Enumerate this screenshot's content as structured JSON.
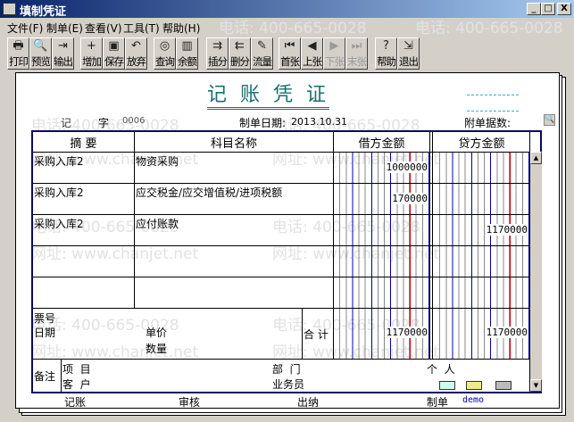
{
  "window": {
    "title": "填制凭证",
    "minimize": "_",
    "maximize": "□",
    "close": "X"
  },
  "menu": [
    "文件(F)",
    "制单(E)",
    "查看(V)",
    "工具(T)",
    "帮助(H)"
  ],
  "toolbar": [
    {
      "label": "打印",
      "icon": "printer-icon",
      "glyph": "🖶"
    },
    {
      "label": "预览",
      "icon": "preview-icon",
      "glyph": "🔍"
    },
    {
      "label": "输出",
      "icon": "export-icon",
      "glyph": "⇥"
    },
    {
      "label": "增加",
      "icon": "add-icon",
      "glyph": "+"
    },
    {
      "label": "保存",
      "icon": "save-icon",
      "glyph": "▣"
    },
    {
      "label": "放弃",
      "icon": "undo-icon",
      "glyph": "↶"
    },
    {
      "label": "查询",
      "icon": "binoculars-icon",
      "glyph": "◎"
    },
    {
      "label": "余额",
      "icon": "chart-icon",
      "glyph": "▥"
    },
    {
      "label": "插分",
      "icon": "insert-row-icon",
      "glyph": "⇉"
    },
    {
      "label": "删分",
      "icon": "delete-row-icon",
      "glyph": "⇇"
    },
    {
      "label": "流量",
      "icon": "pencil-icon",
      "glyph": "✎"
    },
    {
      "label": "首张",
      "icon": "first-icon",
      "glyph": "⏮"
    },
    {
      "label": "上张",
      "icon": "prev-icon",
      "glyph": "◀"
    },
    {
      "label": "下张",
      "icon": "next-icon",
      "glyph": "▶"
    },
    {
      "label": "末张",
      "icon": "last-icon",
      "glyph": "⏭"
    },
    {
      "label": "帮助",
      "icon": "help-icon",
      "glyph": "?"
    },
    {
      "label": "退出",
      "icon": "exit-icon",
      "glyph": "⇲"
    }
  ],
  "watermark": {
    "phone": "电话: 400-665-0028",
    "site": "网址: www.chanjet.net"
  },
  "voucher": {
    "title": "记 账 凭 证",
    "type": "记",
    "zi": "字",
    "number": "0006",
    "date_label": "制单日期:",
    "date": "2013.10.31",
    "attach_label": "附单据数:",
    "headers": {
      "summary": "摘 要",
      "account": "科目名称",
      "debit": "借方金额",
      "credit": "贷方金额"
    },
    "rows": [
      {
        "summary": "采购入库2",
        "account": "物资采购",
        "debit": "1000000",
        "credit": ""
      },
      {
        "summary": "采购入库2",
        "account": "应交税金/应交增值税/进项税额",
        "debit": "170000",
        "credit": ""
      },
      {
        "summary": "采购入库2",
        "account": "应付账款",
        "debit": "",
        "credit": "1170000"
      },
      {
        "summary": "",
        "account": "",
        "debit": "",
        "credit": ""
      },
      {
        "summary": "",
        "account": "",
        "debit": "",
        "credit": ""
      }
    ],
    "ticket_label": "票号",
    "date2_label": "日期",
    "price_label": "单价",
    "qty_label": "数量",
    "total_label": "合 计",
    "total_debit": "1170000",
    "total_credit": "1170000",
    "remark_label": "备注",
    "project_label": "项  目",
    "customer_label": "客  户",
    "dept_label": "部  门",
    "salesman_label": "业务员",
    "person_label": "个  人",
    "footer": {
      "post": "记账",
      "audit": "审核",
      "cashier": "出纳",
      "maker": "制单",
      "maker_name": "demo"
    }
  }
}
